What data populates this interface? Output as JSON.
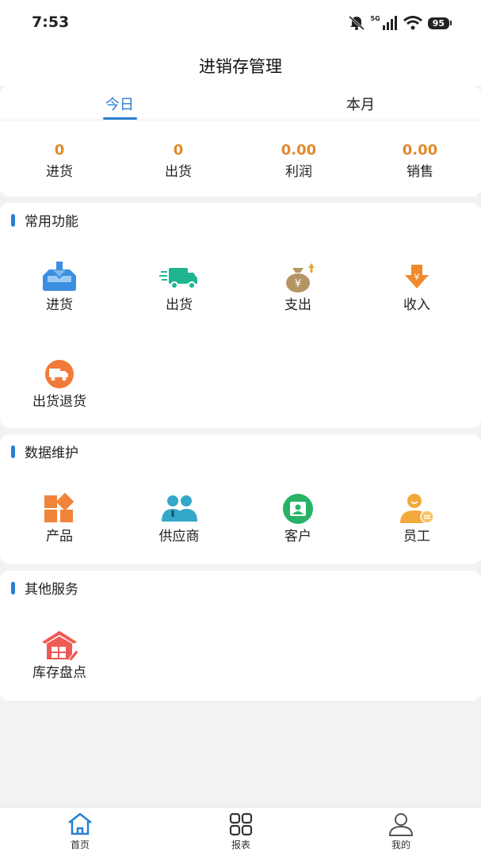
{
  "status_bar": {
    "time": "7:53",
    "network": "5G",
    "battery": "95"
  },
  "header": {
    "title": "进销存管理"
  },
  "tabs": [
    {
      "label": "今日"
    },
    {
      "label": "本月"
    }
  ],
  "summary": [
    {
      "value": "0",
      "label": "进货"
    },
    {
      "value": "0",
      "label": "出货"
    },
    {
      "value": "0.00",
      "label": "利润"
    },
    {
      "value": "0.00",
      "label": "销售"
    }
  ],
  "sections": {
    "common": {
      "title": "常用功能",
      "items": [
        {
          "label": "进货",
          "icon": "inbox-download-icon"
        },
        {
          "label": "出货",
          "icon": "delivery-truck-icon"
        },
        {
          "label": "支出",
          "icon": "money-bag-icon"
        },
        {
          "label": "收入",
          "icon": "yen-down-icon"
        },
        {
          "label": "出货退货",
          "icon": "return-truck-icon"
        }
      ]
    },
    "data": {
      "title": "数据维护",
      "items": [
        {
          "label": "产品",
          "icon": "product-blocks-icon"
        },
        {
          "label": "供应商",
          "icon": "supplier-people-icon"
        },
        {
          "label": "客户",
          "icon": "customer-card-icon"
        },
        {
          "label": "员工",
          "icon": "employee-icon"
        }
      ]
    },
    "other": {
      "title": "其他服务",
      "items": [
        {
          "label": "库存盘点",
          "icon": "warehouse-icon"
        }
      ]
    }
  },
  "bottom_nav": [
    {
      "label": "首页",
      "icon": "home-icon"
    },
    {
      "label": "报表",
      "icon": "grid-report-icon"
    },
    {
      "label": "我的",
      "icon": "user-icon"
    }
  ],
  "colors": {
    "accent": "#2a7ed3",
    "value": "#e08a2c",
    "background": "#f2f2f2"
  }
}
